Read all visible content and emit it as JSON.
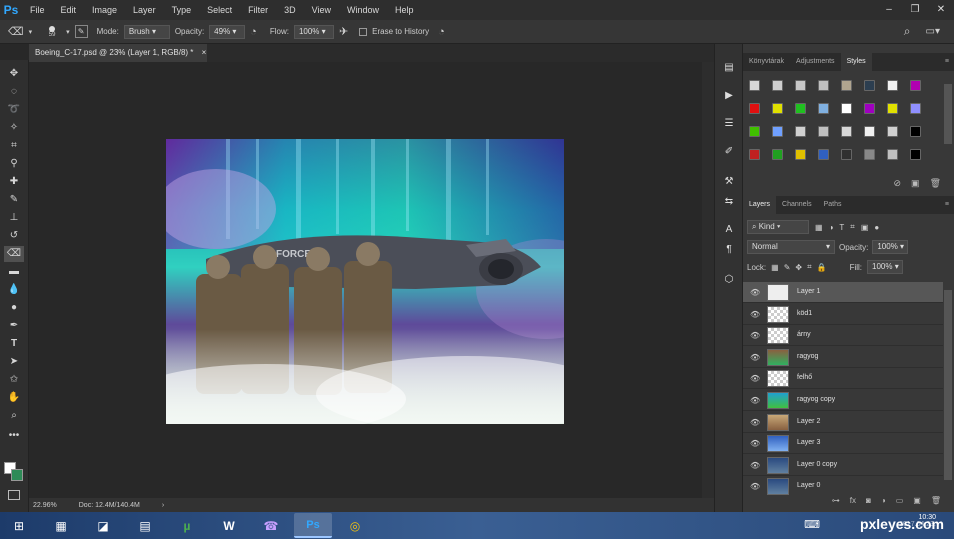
{
  "app": {
    "logo": "Ps"
  },
  "menu": [
    "File",
    "Edit",
    "Image",
    "Layer",
    "Type",
    "Select",
    "Filter",
    "3D",
    "View",
    "Window",
    "Help"
  ],
  "window_controls": [
    "–",
    "❐",
    "✕"
  ],
  "options": {
    "brush_size": "59",
    "mode_label": "Mode:",
    "mode_value": "Brush",
    "opacity_label": "Opacity:",
    "opacity_value": "49%",
    "flow_label": "Flow:",
    "flow_value": "100%",
    "erase_history_label": "Erase to History"
  },
  "document": {
    "tab_title": "Boeing_C-17.psd @ 23% (Layer 1, RGB/8) *",
    "tab_close": "×",
    "zoom": "22.96%",
    "doc_size": "Doc: 12.4M/140.4M",
    "plane_text": "AIR FORCE"
  },
  "styles_panel": {
    "tabs": [
      "Könyvtárak",
      "Adjustments",
      "Styles"
    ],
    "active_tab": "Styles",
    "swatches": [
      [
        "#d8d8d8",
        "#cfcfcf",
        "#c8c8c8",
        "#bfbfbf",
        "#b0a590",
        "#2c3e50",
        "#f2f2f2",
        "#b000b0"
      ],
      [
        "#e01010",
        "#e0e000",
        "#20c020",
        "#80b0e0",
        "#ffffff",
        "#a000c0",
        "#e0e000",
        "#9090ff"
      ],
      [
        "#40c000",
        "#70a0ff",
        "#d0d0d0",
        "#c0c0c0",
        "#d8d8d8",
        "#f0f0f0",
        "#d0d0d0",
        "#000000"
      ],
      [
        "#c02020",
        "#20a020",
        "#e0c000",
        "#3060c0",
        "#303030",
        "#888888",
        "#c0c0c0",
        "#000000"
      ]
    ]
  },
  "layers_panel": {
    "tabs": [
      "Layers",
      "Channels",
      "Paths"
    ],
    "active_tab": "Layers",
    "filter_label": "Kind",
    "blend_mode": "Normal",
    "opacity_label": "Opacity:",
    "opacity_value": "100%",
    "lock_label": "Lock:",
    "fill_label": "Fill:",
    "fill_value": "100%",
    "layers": [
      {
        "name": "Layer 1",
        "selected": true,
        "thumb": "photo"
      },
      {
        "name": "köd1",
        "selected": false,
        "thumb": "transparent"
      },
      {
        "name": "árny",
        "selected": false,
        "thumb": "transparent"
      },
      {
        "name": "ragyog",
        "selected": false,
        "thumb": "aurora"
      },
      {
        "name": "felhő",
        "selected": false,
        "thumb": "transparent"
      },
      {
        "name": "ragyog copy",
        "selected": false,
        "thumb": "aurora2"
      },
      {
        "name": "Layer 2",
        "selected": false,
        "thumb": "ground"
      },
      {
        "name": "Layer 3",
        "selected": false,
        "thumb": "sky"
      },
      {
        "name": "Layer 0 copy",
        "selected": false,
        "thumb": "plane"
      },
      {
        "name": "Layer 0",
        "selected": false,
        "thumb": "plane"
      }
    ]
  },
  "taskbar": {
    "items": [
      "⊞",
      "▦",
      "◪",
      "▤",
      "µ",
      "W",
      "☎",
      "Ps",
      "◎"
    ],
    "active_index": 7,
    "watermark": "pxleyes.com",
    "clock_time": "10:30",
    "clock_date": "2017.04.23."
  },
  "colors": {
    "accent": "#31a8ff",
    "panel_bg": "#383838",
    "selected_layer": "#575757"
  }
}
